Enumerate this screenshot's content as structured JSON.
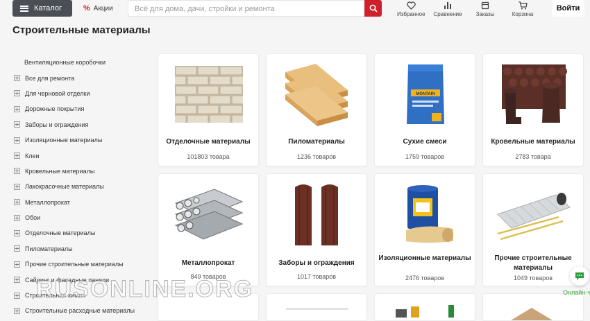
{
  "header": {
    "catalog_label": "Каталог",
    "promo_label": "Акции",
    "search_placeholder": "Всё для дома, дачи, стройки и ремонта",
    "nav": [
      {
        "label": "Избранное",
        "icon": "heart-icon"
      },
      {
        "label": "Сравнение",
        "icon": "compare-icon"
      },
      {
        "label": "Заказы",
        "icon": "orders-icon"
      },
      {
        "label": "Корзина",
        "icon": "cart-icon"
      }
    ],
    "login_label": "Войти"
  },
  "page_title": "Строительные материалы",
  "sidebar": {
    "items": [
      {
        "label": "Вентиляционные коробочки",
        "expandable": false
      },
      {
        "label": "Все для ремонта",
        "expandable": true
      },
      {
        "label": "Для черновой отделки",
        "expandable": true
      },
      {
        "label": "Дорожные покрытия",
        "expandable": true
      },
      {
        "label": "Заборы и ограждения",
        "expandable": true
      },
      {
        "label": "Изоляционные материалы",
        "expandable": true
      },
      {
        "label": "Клеи",
        "expandable": true
      },
      {
        "label": "Кровельные материалы",
        "expandable": true
      },
      {
        "label": "Лакокрасочные материалы",
        "expandable": true
      },
      {
        "label": "Металлопрокат",
        "expandable": true
      },
      {
        "label": "Обои",
        "expandable": true
      },
      {
        "label": "Отделочные материалы",
        "expandable": true
      },
      {
        "label": "Пиломатериалы",
        "expandable": true
      },
      {
        "label": "Прочие строительные материалы",
        "expandable": true
      },
      {
        "label": "Сайдинг и фасадные панели",
        "expandable": true
      },
      {
        "label": "Строительная химия",
        "expandable": true
      },
      {
        "label": "Строительные расходные материалы",
        "expandable": true
      }
    ]
  },
  "categories": [
    {
      "name": "Отделочные материалы",
      "count": "101803 товара",
      "image": "brick-wall-image"
    },
    {
      "name": "Пиломатериалы",
      "count": "1236 товаров",
      "image": "lumber-boards-image"
    },
    {
      "name": "Сухие смеси",
      "count": "1759 товаров",
      "image": "dry-mix-bag-image"
    },
    {
      "name": "Кровельные материалы",
      "count": "2783 товара",
      "image": "roofing-image"
    },
    {
      "name": "Металлопрокат",
      "count": "849 товаров",
      "image": "metal-pipes-image"
    },
    {
      "name": "Заборы и ограждения",
      "count": "1017 товаров",
      "image": "fence-panels-image"
    },
    {
      "name": "Изоляционные материалы",
      "count": "2476 товаров",
      "image": "insulation-image"
    },
    {
      "name": "Прочие строительные материалы",
      "count": "1049 товаров",
      "image": "mesh-roll-image"
    }
  ],
  "bag_text": "MONTAIN",
  "chat_label": "Онлайн-ч",
  "watermark": "RUSONLINE.ORG",
  "colors": {
    "accent": "#d0202b",
    "catalog_button": "#4a4f55",
    "online": "#3aa83a"
  }
}
